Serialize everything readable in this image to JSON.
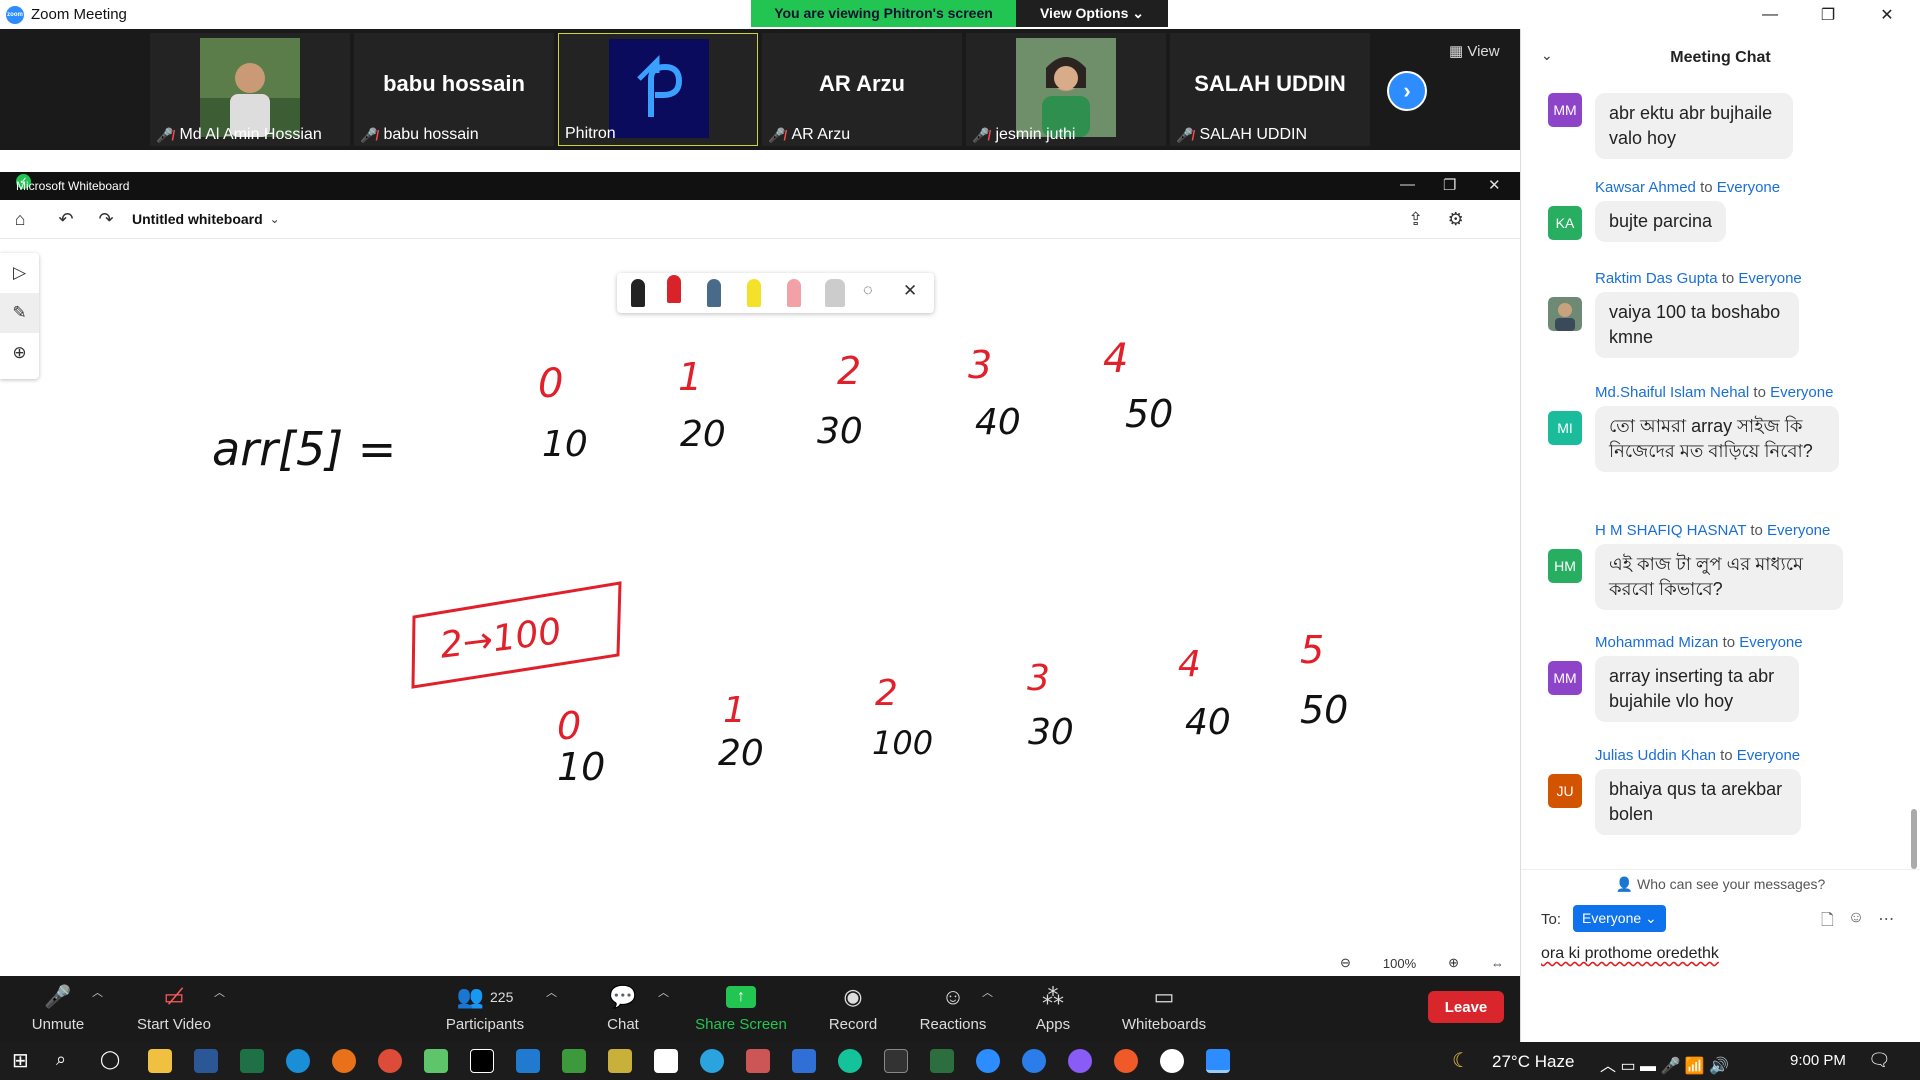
{
  "window": {
    "title": "Zoom Meeting",
    "logo_text": "zoom"
  },
  "banner": {
    "viewing": "You are viewing Phitron's screen",
    "view_options": "View Options ⌄"
  },
  "strip": {
    "participants": [
      {
        "name": "Md Al Amin Hossian",
        "display": "",
        "has_photo": true
      },
      {
        "name": "babu hossain",
        "display": "babu hossain",
        "has_photo": false
      },
      {
        "name": "Phitron",
        "display": "",
        "has_photo": true,
        "active": true
      },
      {
        "name": "AR Arzu",
        "display": "AR Arzu",
        "has_photo": false
      },
      {
        "name": "jesmin juthi",
        "display": "",
        "has_photo": true
      },
      {
        "name": "SALAH UDDIN",
        "display": "SALAH UDDIN",
        "has_photo": false
      }
    ],
    "view_label": "View"
  },
  "whiteboard": {
    "app_title": "Microsoft Whiteboard",
    "board_name": "Untitled whiteboard",
    "zoom": "100%",
    "handwriting": {
      "row1_label": "arr[5] =",
      "row1_indices": [
        "0",
        "1",
        "2",
        "3",
        "4"
      ],
      "row1_values": [
        "10",
        "20",
        "30",
        "40",
        "50"
      ],
      "box_text": "2→100",
      "row2_indices": [
        "0",
        "1",
        "2",
        "3",
        "4",
        "5"
      ],
      "row2_values": [
        "10",
        "20",
        "100",
        "30",
        "40",
        "50"
      ]
    }
  },
  "controls": {
    "unmute": "Unmute",
    "start_video": "Start Video",
    "participants": "Participants",
    "participant_count": "225",
    "chat": "Chat",
    "share_screen": "Share Screen",
    "record": "Record",
    "reactions": "Reactions",
    "apps": "Apps",
    "whiteboards": "Whiteboards",
    "leave": "Leave"
  },
  "chat": {
    "title": "Meeting Chat",
    "messages": [
      {
        "initials": "MM",
        "color": "#8e44c9",
        "sender": "",
        "text": "abr ektu abr bujhaile valo hoy"
      },
      {
        "initials": "KA",
        "color": "#27ae60",
        "sender": "Kawsar Ahmed",
        "text": "bujte parcina"
      },
      {
        "initials": "",
        "color": "#5b7a6a",
        "sender": "Raktim Das Gupta",
        "text": "vaiya 100 ta boshabo kmne"
      },
      {
        "initials": "MI",
        "color": "#1abc9c",
        "sender": "Md.Shaiful Islam Nehal",
        "text": "তো আমরা array সাইজ কি নিজেদের মত বাড়িয়ে নিবো?"
      },
      {
        "initials": "HM",
        "color": "#27ae60",
        "sender": "H M SHAFIQ HASNAT",
        "text": "এই কাজ টা লুপ এর মাধ্যমে করবো কিভাবে?"
      },
      {
        "initials": "MM",
        "color": "#8e44c9",
        "sender": "Mohammad Mizan",
        "text": "array inserting ta abr bujahile vlo hoy"
      },
      {
        "initials": "JU",
        "color": "#d35400",
        "sender": "Julias Uddin Khan",
        "text": "bhaiya qus ta arekbar bolen"
      }
    ],
    "to_word": "to",
    "recipient": "Everyone",
    "who_can_see": "Who can see your messages?",
    "to_label": "To:",
    "everyone_button": "Everyone ⌄",
    "draft": "ora ki prothome oredethk"
  },
  "taskbar": {
    "weather": "27°C  Haze",
    "time": "9:00 PM"
  }
}
